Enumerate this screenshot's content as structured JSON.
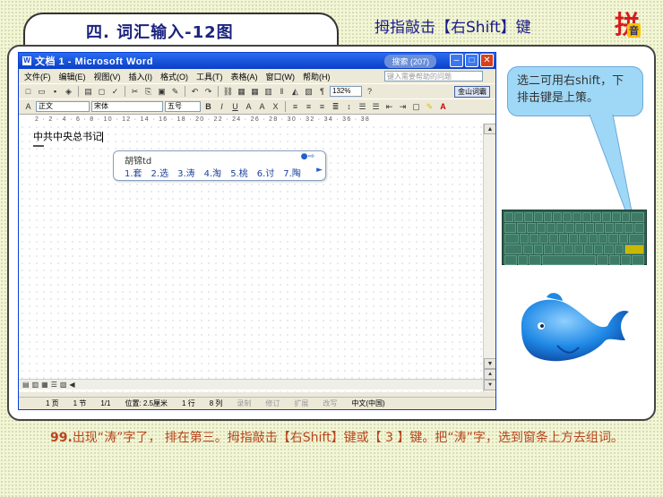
{
  "header": {
    "title": "四. 词汇输入-12图",
    "subtitle": "拇指敲击【右Shift】键",
    "logo": {
      "big": "拼",
      "small": "音"
    }
  },
  "word_window": {
    "title": "文档 1 - Microsoft Word",
    "title_pill": "搜索 (207)",
    "menus": [
      "文件(F)",
      "编辑(E)",
      "视图(V)",
      "插入(I)",
      "格式(O)",
      "工具(T)",
      "表格(A)",
      "窗口(W)",
      "帮助(H)"
    ],
    "help_placeholder": "键入需要帮助的问题",
    "style_combo": "正文",
    "font_combo": "宋体",
    "size_combo": "五号",
    "zoom_combo": "132%",
    "jinshan_button": "金山词霸",
    "ruler_text": "2 · 2 · 4 · 6 · 8 · 10 · 12 · 14 · 16 · 18 · 20 · 22 · 24 · 26 · 28 · 30 · 32 · 34 · 36 · 38",
    "doc_text": "中共中央总书记",
    "status": {
      "page": "1 页",
      "section": "1 节",
      "pages": "1/1",
      "position": "位置: 2.5厘米",
      "line": "1 行",
      "col": "8 列",
      "rec": "录制",
      "trk": "修订",
      "ext": "扩展",
      "ovr": "改写",
      "lang": "中文(中国)"
    }
  },
  "ime": {
    "input": "胡锦td",
    "candidates": [
      "1.套",
      "2.选",
      "3.涛",
      "4.淘",
      "5.桃",
      "6.讨",
      "7.陶"
    ],
    "more_indicator": "●⇨",
    "next_arrow": "►"
  },
  "callout": {
    "text": "选二可用右shift，下排击键是上策。"
  },
  "caption": {
    "number": "99.",
    "text": "出现“涛”字了， 排在第三。拇指敲击【右Shift】键或【 3 】键。把“涛”字，选到窗条上方去组词。"
  },
  "colors": {
    "title": "#1a237e",
    "caption": "#b8441c",
    "callout": "#9fd8f7",
    "keyboard": "#2e6050",
    "fish": "#1e88e5"
  }
}
